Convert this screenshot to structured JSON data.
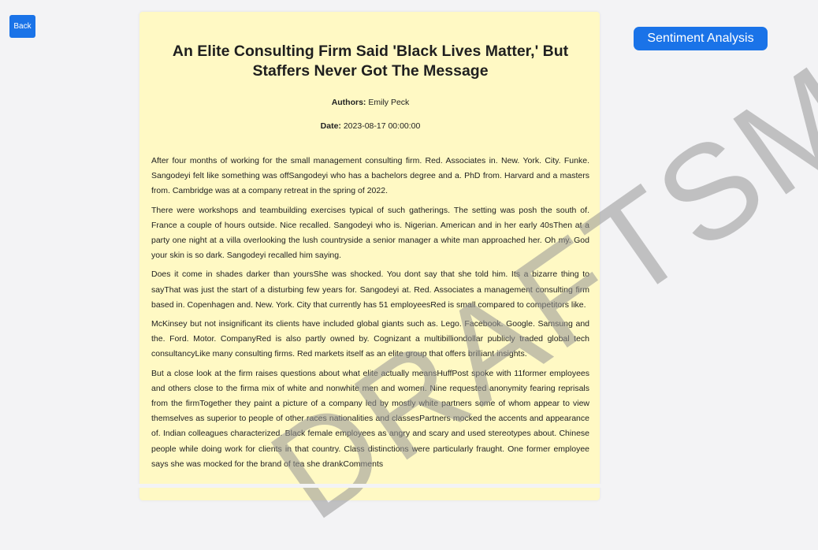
{
  "buttons": {
    "back_label": "Back",
    "sentiment_label": "Sentiment Analysis"
  },
  "article": {
    "title": "An Elite Consulting Firm Said 'Black Lives Matter,' But Staffers Never Got The Message",
    "authors_label": "Authors:",
    "authors_value": "Emily Peck",
    "date_label": "Date:",
    "date_value": "2023-08-17 00:00:00",
    "paragraphs": [
      "After four months of working for the small management consulting firm. Red. Associates in. New. York. City. Funke. Sangodeyi felt like something was offSangodeyi who has a bachelors degree and a. PhD from. Harvard and a masters from. Cambridge was at a company retreat in the spring of 2022.",
      "There were workshops and teambuilding exercises typical of such gatherings. The setting was posh the south of. France a couple of hours outside. Nice recalled. Sangodeyi who is. Nigerian. American and in her early 40sThen at a party one night at a villa overlooking the lush countryside a senior manager a white man approached her. Oh my. God your skin is so dark. Sangodeyi recalled him saying.",
      "Does it come in shades darker than yoursShe was shocked. You dont say that she told him. Its a bizarre thing to sayThat was just the start of a disturbing few years for. Sangodeyi at. Red. Associates a management consulting firm based in. Copenhagen and. New. York. City that currently has 51 employeesRed is small compared to competitors like.",
      "McKinsey but not insignificant its clients have included global giants such as. Lego. Facebook. Google. Samsung and the. Ford. Motor. CompanyRed is also partly owned by. Cognizant a multibilliondollar publicly traded global tech consultancyLike many consulting firms. Red markets itself as an elite group that offers brilliant insights.",
      "But a close look at the firm raises questions about what elite actually meansHuffPost spoke with 11former employees and others close to the firma mix of white and nonwhite men and women. Nine requested anonymity fearing reprisals from the firmTogether they paint a picture of a company led by mostly white partners some of whom appear to view themselves as superior to people of other races nationalities and classesPartners mocked the accents and appearance of. Indian colleagues characterized. Black female employees as angry and scary and used stereotypes about. Chinese people while doing work for clients in that country. Class distinctions were particularly fraught. One former employee says she was mocked for the brand of tea she drankComments"
    ]
  },
  "watermark": {
    "text": "DRAFTSM",
    "visible_text": "SM",
    "color": "#969696"
  },
  "colors": {
    "accent": "#1a73e8",
    "article_bg": "#fff9c4",
    "page_bg": "#f3f3f5"
  }
}
